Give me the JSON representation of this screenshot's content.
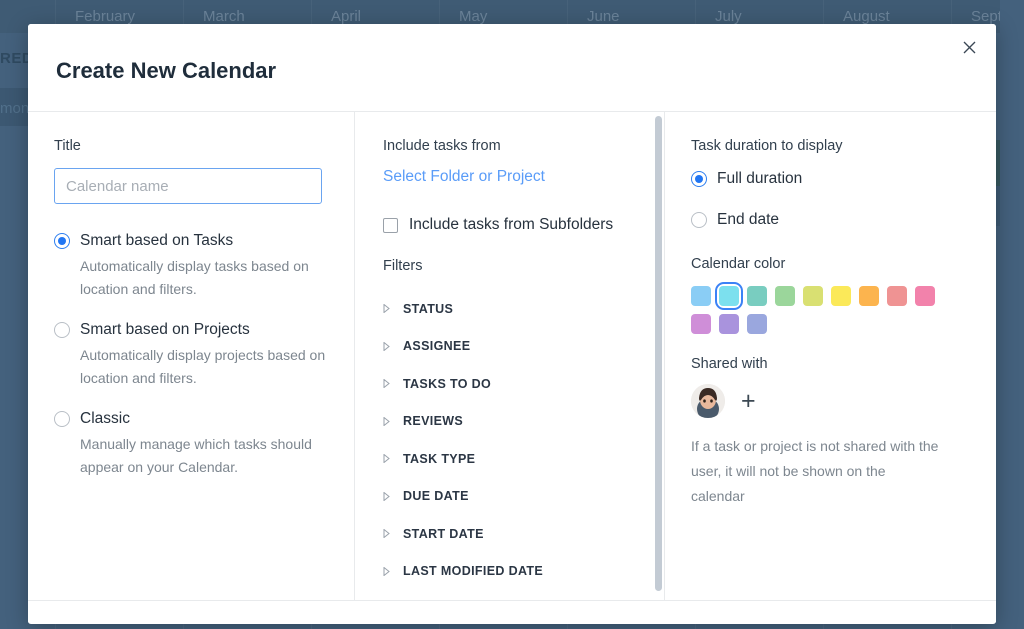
{
  "background": {
    "months": [
      "February",
      "March",
      "April",
      "May",
      "June",
      "July",
      "August",
      "September"
    ],
    "shared_label": "RED",
    "mon_label": "mon"
  },
  "modal": {
    "title": "Create New Calendar",
    "close_icon": "close-icon",
    "left": {
      "title_label": "Title",
      "title_placeholder": "Calendar name",
      "title_value": "",
      "options": [
        {
          "label": "Smart based on Tasks",
          "desc": "Automatically display tasks based on location and filters.",
          "selected": true
        },
        {
          "label": "Smart based on Projects",
          "desc": "Automatically display projects based on location and filters.",
          "selected": false
        },
        {
          "label": "Classic",
          "desc": "Manually manage which tasks should appear on your Calendar.",
          "selected": false
        }
      ]
    },
    "middle": {
      "include_label": "Include tasks from",
      "select_link": "Select Folder or Project",
      "subfolders_label": "Include tasks from Subfolders",
      "subfolders_checked": false,
      "filters_label": "Filters",
      "filters": [
        "STATUS",
        "ASSIGNEE",
        "TASKS TO DO",
        "REVIEWS",
        "TASK TYPE",
        "DUE DATE",
        "START DATE",
        "LAST MODIFIED DATE"
      ]
    },
    "right": {
      "duration_label": "Task duration to display",
      "duration_options": [
        {
          "label": "Full duration",
          "selected": true
        },
        {
          "label": "End date",
          "selected": false
        }
      ],
      "color_label": "Calendar color",
      "colors": [
        "#8acdf5",
        "#7ce0ee",
        "#79cdc0",
        "#9bd69b",
        "#d9e072",
        "#fbe959",
        "#fcb košik",
        "#ef9393",
        "#f282ab",
        "#cf8ed8",
        "#a993dd",
        "#9aa7de"
      ],
      "colors_fixed": [
        "#8acdf5",
        "#7ce0ee",
        "#79cdc0",
        "#9bd69b",
        "#d9e072",
        "#fbe959",
        "#fcb košik",
        "#ef9393",
        "#f282ab",
        "#cf8ed8",
        "#a993dd",
        "#9aa7de"
      ],
      "selected_color_index": 1,
      "shared_label": "Shared with",
      "add_icon": "plus-icon",
      "hint": "If a task or project is not shared with the user, it will not be shown on the calendar"
    }
  }
}
